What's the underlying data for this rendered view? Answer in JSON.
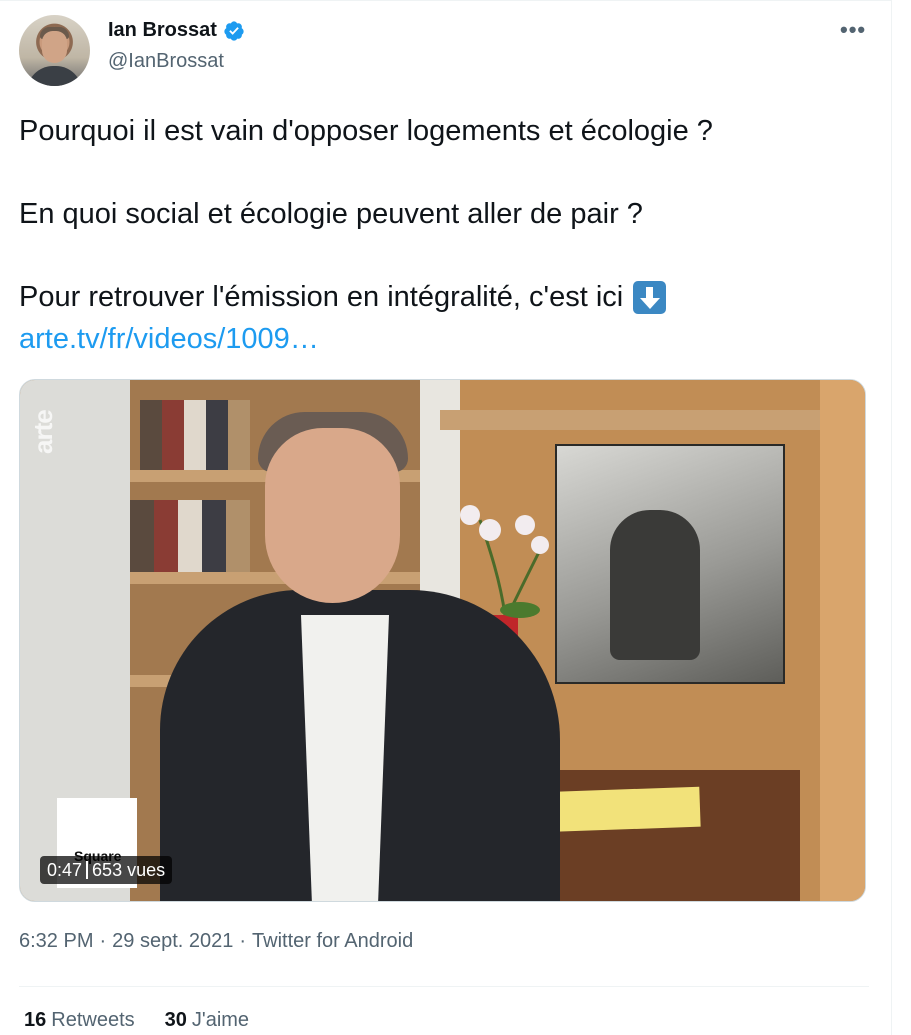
{
  "author": {
    "display_name": "Ian Brossat",
    "handle": "@IanBrossat",
    "verified_color": "#1d9bf0"
  },
  "tweet": {
    "line1": "Pourquoi il est vain d'opposer logements et écologie ?",
    "line2": "En quoi social et écologie peuvent aller de pair ?",
    "line3": "Pour retrouver l'émission en intégralité, c'est ici",
    "line3_emoji": "down-arrow-emoji",
    "link": "arte.tv/fr/videos/1009…"
  },
  "media": {
    "watermark": "arte",
    "show_logo": "Square",
    "duration": "0:47",
    "views": "653 vues"
  },
  "meta": {
    "time": "6:32 PM",
    "separator": "·",
    "date": "29 sept. 2021",
    "source": "Twitter for Android"
  },
  "stats": {
    "retweets_count": "16",
    "retweets_label": "Retweets",
    "likes_count": "30",
    "likes_label": "J'aime"
  },
  "colors": {
    "link": "#1d9bf0",
    "secondary_text": "#536471",
    "primary_text": "#0f1419"
  }
}
